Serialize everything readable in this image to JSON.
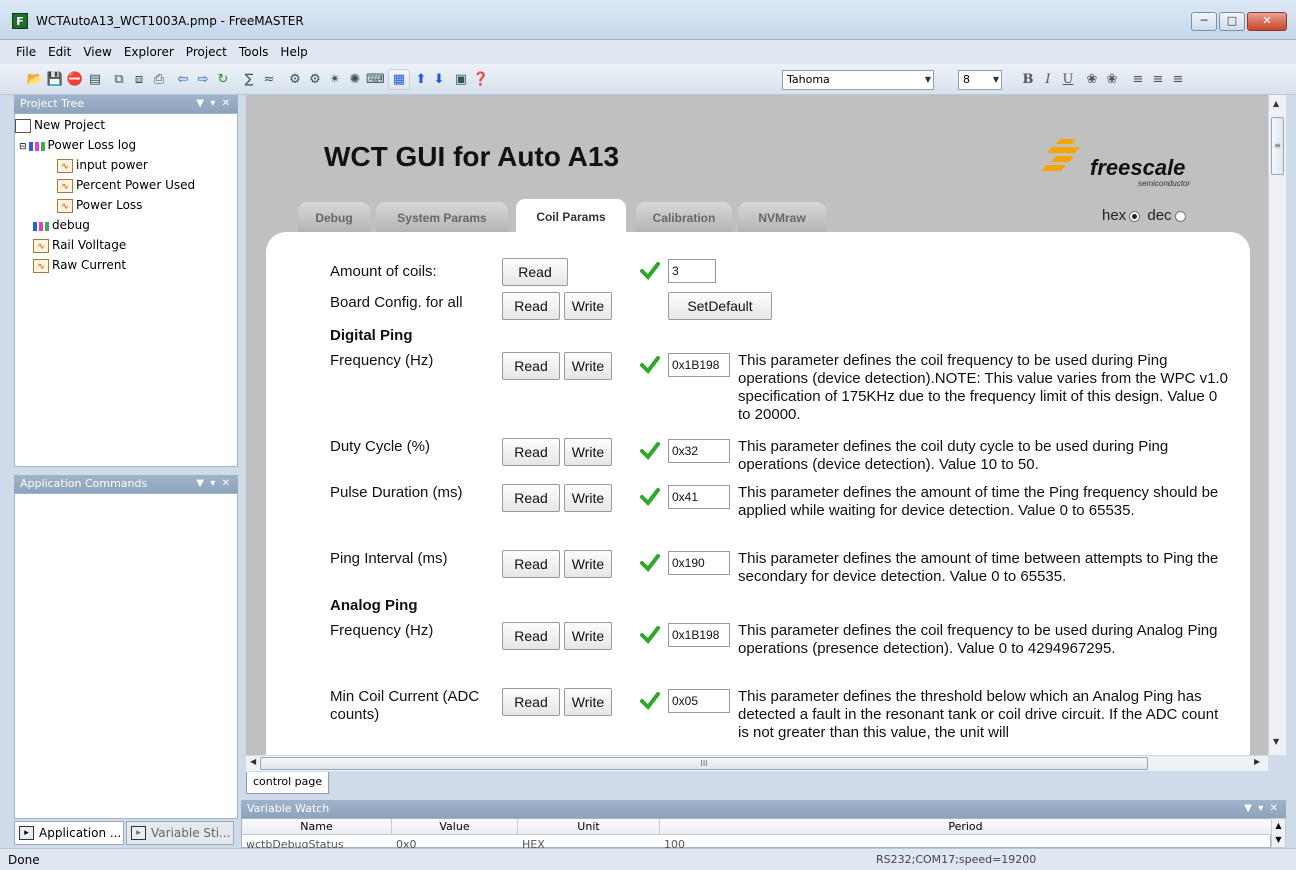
{
  "window": {
    "title": "WCTAutoA13_WCT1003A.pmp - FreeMASTER",
    "icon": "F"
  },
  "menu": [
    "File",
    "Edit",
    "View",
    "Explorer",
    "Project",
    "Tools",
    "Help"
  ],
  "toolbar": {
    "font_name": "Tahoma",
    "font_size": "8"
  },
  "project_tree": {
    "header": "Project Tree",
    "items": [
      {
        "label": "New Project"
      },
      {
        "label": "Power Loss log"
      },
      {
        "label": "input power"
      },
      {
        "label": "Percent Power Used"
      },
      {
        "label": "Power Loss"
      },
      {
        "label": "debug"
      },
      {
        "label": "Rail Volltage"
      },
      {
        "label": "Raw Current"
      }
    ]
  },
  "app_commands": {
    "header": "Application Commands"
  },
  "bottom_tabs": [
    "Application ...",
    "Variable Sti..."
  ],
  "gui": {
    "title": "WCT GUI for Auto A13",
    "logo": {
      "brand": "freescale",
      "sub": "semiconductor",
      "color": "#f5a400"
    },
    "hexdec": {
      "hex": "hex",
      "dec": "dec",
      "selected": "hex"
    },
    "tabs": [
      "Debug",
      "System Params",
      "Coil Params",
      "Calibration",
      "NVMraw"
    ],
    "active_tab": "Coil Params",
    "read": "Read",
    "write": "Write",
    "setdefault": "SetDefault",
    "amount_of_coils": {
      "label": "Amount of coils:",
      "value": "3"
    },
    "board_config": {
      "label": "Board Config. for all"
    },
    "digital_ping": "Digital Ping",
    "analog_ping": "Analog Ping",
    "params": [
      {
        "label": "Frequency (Hz)",
        "value": "0x1B198",
        "desc": "This parameter defines the coil frequency to be used during Ping operations (device detection).NOTE: This value varies from the WPC v1.0 specification of 175KHz due to the frequency limit of this design. Value 0 to 20000."
      },
      {
        "label": "Duty Cycle (%)",
        "value": "0x32",
        "desc": "This parameter defines the coil duty cycle to be used during Ping operations (device detection). Value 10 to 50."
      },
      {
        "label": "Pulse Duration (ms)",
        "value": "0x41",
        "desc": "This parameter defines the amount of time the Ping frequency should be applied while waiting for device detection. Value 0 to 65535."
      },
      {
        "label": "Ping Interval (ms)",
        "value": "0x190",
        "desc": "This parameter defines the amount of time between attempts to Ping the secondary for device detection. Value 0 to 65535."
      },
      {
        "label": "Frequency (Hz)",
        "value": "0x1B198",
        "desc": "This parameter defines the coil frequency to be used during Analog Ping operations (presence detection). Value 0 to 4294967295."
      },
      {
        "label": "Min Coil Current (ADC counts)",
        "value": "0x05",
        "desc": "This parameter defines the threshold below which an Analog Ping has detected a fault in the resonant tank or coil drive circuit. If the ADC count is not greater than this value, the unit will"
      }
    ]
  },
  "page_tab": "control page",
  "variable_watch": {
    "header": "Variable Watch",
    "columns": [
      "Name",
      "Value",
      "Unit",
      "Period"
    ],
    "row": [
      "wctbDebugStatus",
      "0x0",
      "HEX",
      "100"
    ]
  },
  "status": {
    "left": "Done",
    "connection": "RS232;COM17;speed=19200"
  }
}
